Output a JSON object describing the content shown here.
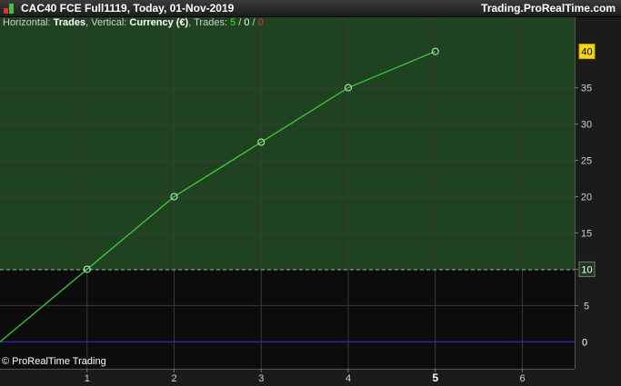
{
  "header": {
    "title": "CAC40 FCE Full1119, Today, 01-Nov-2019",
    "brand": "Trading.ProRealTime.com"
  },
  "info": {
    "horizontal_prefix": "Horizontal: ",
    "horizontal_value": "Trades",
    "vertical_prefix": ", Vertical: ",
    "vertical_value": "Currency (€)",
    "trades_prefix": ", Trades: ",
    "trades_won": "5",
    "sep1": " / ",
    "trades_neutral": "0",
    "sep2": " / ",
    "trades_lost": "0"
  },
  "footer": {
    "copyright": "© ProRealTime Trading"
  },
  "colors": {
    "plot_background": "#0c0c0c",
    "equity_zone": "#1f4320",
    "line": "#3fd33f",
    "zero_line": "#2a2ae0",
    "grid": "#3a3a3a",
    "last_value_badge": "#f5d61b",
    "won": "#40e040",
    "neutral": "#d0d0d0",
    "lost": "#e03030"
  },
  "chart_data": {
    "type": "line",
    "x": [
      0,
      1,
      2,
      3,
      4,
      5
    ],
    "series": [
      {
        "values": [
          0,
          10,
          20,
          27.5,
          35,
          40
        ]
      }
    ],
    "x_ticks": [
      1,
      2,
      3,
      4,
      5,
      6
    ],
    "y_ticks": [
      0,
      5,
      10,
      15,
      20,
      25,
      30,
      35
    ],
    "xlim": [
      0,
      6.6
    ],
    "ylim": [
      -3.7,
      44.7
    ],
    "reference_line": {
      "value": 10,
      "label": "10",
      "style": "dashed"
    },
    "last_value_label": "40",
    "zero_label": "0",
    "grid": true
  }
}
